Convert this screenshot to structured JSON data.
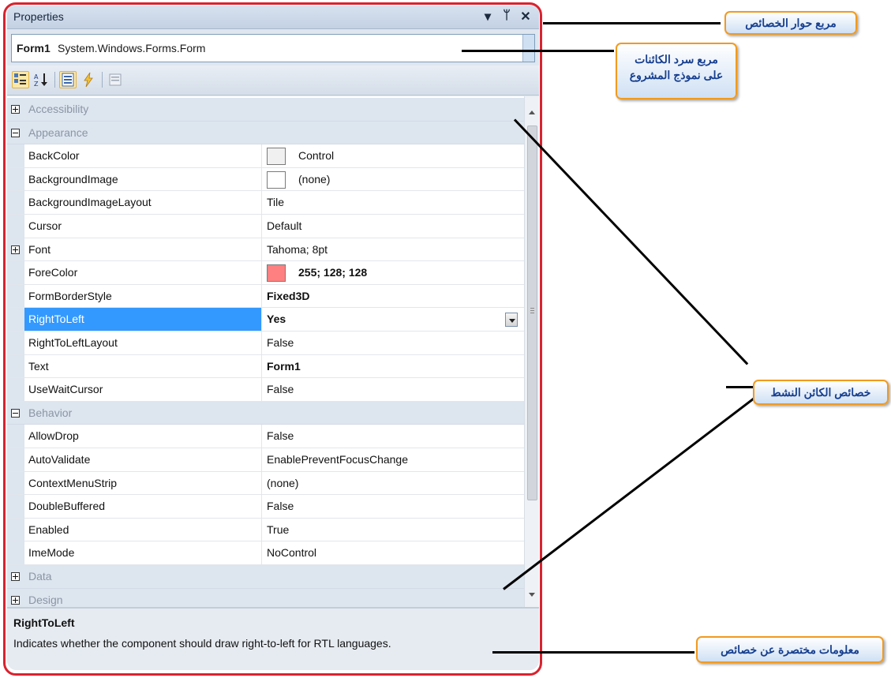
{
  "panel": {
    "title": "Properties",
    "title_icons": [
      "▾",
      "ᛘ",
      "✕"
    ]
  },
  "object_selector": {
    "name": "Form1",
    "type": "System.Windows.Forms.Form"
  },
  "grid": {
    "rows": [
      {
        "kind": "category",
        "name": "Accessibility",
        "expanded": false
      },
      {
        "kind": "category",
        "name": "Appearance",
        "expanded": true
      },
      {
        "kind": "prop",
        "name": "BackColor",
        "value": "Control",
        "swatch": "#f0f0f0"
      },
      {
        "kind": "prop",
        "name": "BackgroundImage",
        "value": "(none)",
        "swatch": "#ffffff"
      },
      {
        "kind": "prop",
        "name": "BackgroundImageLayout",
        "value": "Tile"
      },
      {
        "kind": "prop",
        "name": "Cursor",
        "value": "Default"
      },
      {
        "kind": "prop",
        "name": "Font",
        "value": "Tahoma; 8pt",
        "expandable": true
      },
      {
        "kind": "prop",
        "name": "ForeColor",
        "value": "255; 128; 128",
        "swatch": "#ff8080",
        "bold": true
      },
      {
        "kind": "prop",
        "name": "FormBorderStyle",
        "value": "Fixed3D",
        "bold": true
      },
      {
        "kind": "prop",
        "name": "RightToLeft",
        "value": "Yes",
        "bold": true,
        "selected": true
      },
      {
        "kind": "prop",
        "name": "RightToLeftLayout",
        "value": "False"
      },
      {
        "kind": "prop",
        "name": "Text",
        "value": "Form1",
        "bold": true
      },
      {
        "kind": "prop",
        "name": "UseWaitCursor",
        "value": "False"
      },
      {
        "kind": "category",
        "name": "Behavior",
        "expanded": true
      },
      {
        "kind": "prop",
        "name": "AllowDrop",
        "value": "False"
      },
      {
        "kind": "prop",
        "name": "AutoValidate",
        "value": "EnablePreventFocusChange"
      },
      {
        "kind": "prop",
        "name": "ContextMenuStrip",
        "value": "(none)"
      },
      {
        "kind": "prop",
        "name": "DoubleBuffered",
        "value": "False"
      },
      {
        "kind": "prop",
        "name": "Enabled",
        "value": "True"
      },
      {
        "kind": "prop",
        "name": "ImeMode",
        "value": "NoControl"
      },
      {
        "kind": "category",
        "name": "Data",
        "expanded": false
      },
      {
        "kind": "category",
        "name": "Design",
        "expanded": false
      }
    ]
  },
  "description": {
    "title": "RightToLeft",
    "text": "Indicates whether the component should draw right-to-left for RTL languages."
  },
  "annotations": {
    "window": "مربع حوار الخصائص",
    "objects_line1": "مربع سرد الكائنات",
    "objects_line2": "على نموذج المشروع",
    "active_props": "خصائص الكائن النشط",
    "brief_info": "معلومات مختصرة عن خصائص"
  },
  "colors": {
    "frame": "#d9232e",
    "callout_border": "#f29a1f",
    "selection": "#3399ff"
  }
}
